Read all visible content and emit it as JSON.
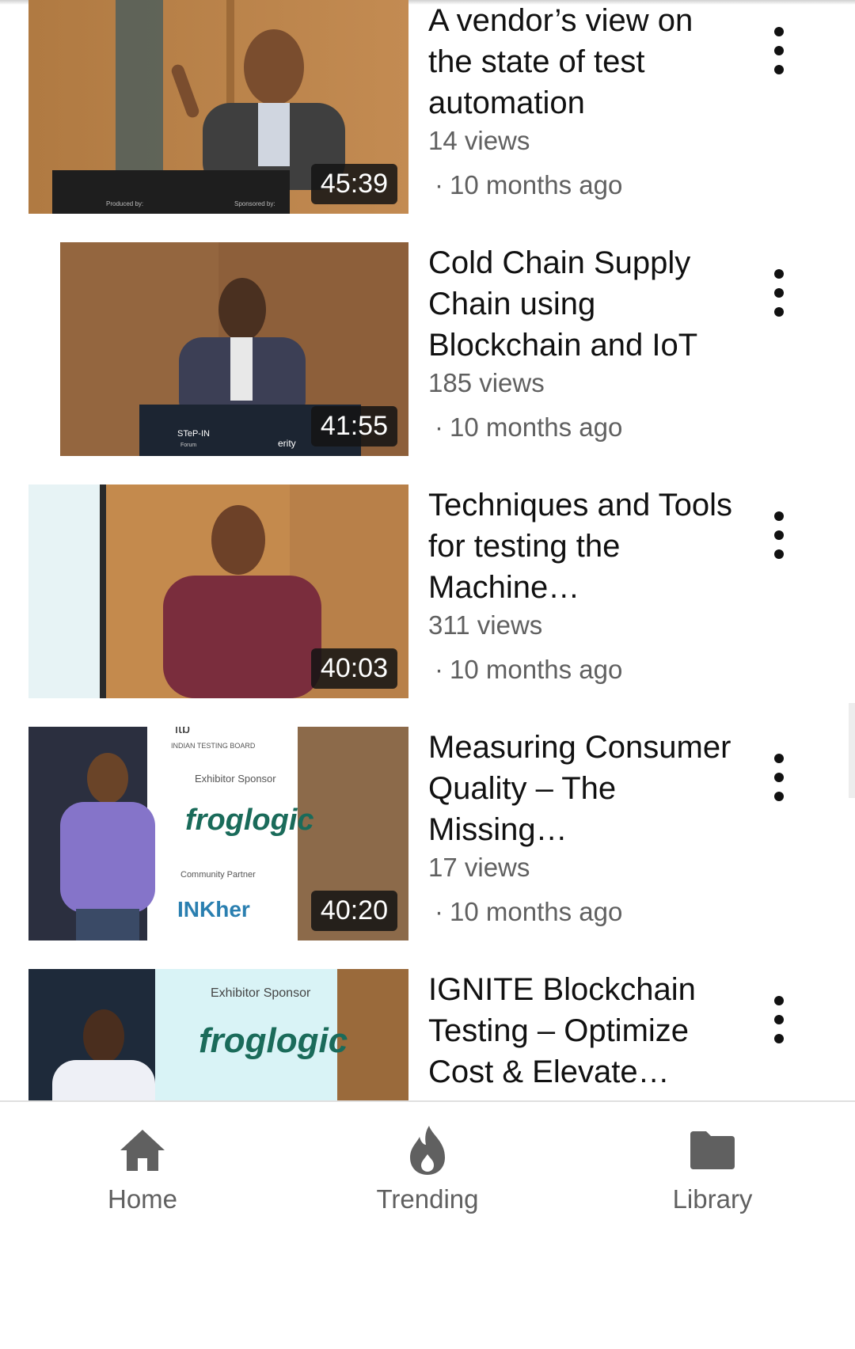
{
  "videos": [
    {
      "title": "A vendor’s view on the state of test automation",
      "views": "14 views",
      "age": "10 months ago",
      "duration": "45:39",
      "thumb_colors": [
        "#a9743f",
        "#6b5237",
        "#2b2b2b"
      ]
    },
    {
      "title": "Cold Chain Supply Chain using Blockchain and IoT",
      "views": "185 views",
      "age": "10 months ago",
      "duration": "41:55",
      "thumb_colors": [
        "#8d5f3a",
        "#6a4630",
        "#1f2630"
      ]
    },
    {
      "title": "Techniques and Tools for testing the Machine…",
      "views": "311 views",
      "age": "10 months ago",
      "duration": "40:03",
      "thumb_colors": [
        "#c48a4d",
        "#9a6a3b",
        "#7a2d3d"
      ]
    },
    {
      "title": "Measuring Consumer Quality – The Missing…",
      "views": "17 views",
      "age": "10 months ago",
      "duration": "40:20",
      "thumb_colors": [
        "#2b2f3f",
        "#ffffff",
        "#8c6a4a"
      ]
    },
    {
      "title": "IGNITE Blockchain Testing – Optimize Cost & Elevate…",
      "views": "",
      "age": "",
      "duration": "",
      "thumb_colors": [
        "#1e2a3a",
        "#d9f3f6",
        "#9a6a3b"
      ]
    }
  ],
  "thumb_text": {
    "produced_by": "Produced by:",
    "sponsored_by": "Sponsored by:",
    "stepin": "STeP-IN",
    "forum": "Forum",
    "erity": "erity",
    "itb": "itb",
    "itb_full": "INDIAN TESTING BOARD",
    "exhibitor_sponsor": "Exhibitor Sponsor",
    "froglogic": "froglogic",
    "community_partner": "Community Partner",
    "inkher": "INKher"
  },
  "bottom_nav": {
    "home": {
      "label": "Home",
      "icon": "home-icon"
    },
    "trending": {
      "label": "Trending",
      "icon": "flame-icon"
    },
    "library": {
      "label": "Library",
      "icon": "folder-icon"
    }
  },
  "colors": {
    "text_primary": "#111111",
    "text_secondary": "#606060",
    "duration_bg": "#141414"
  }
}
